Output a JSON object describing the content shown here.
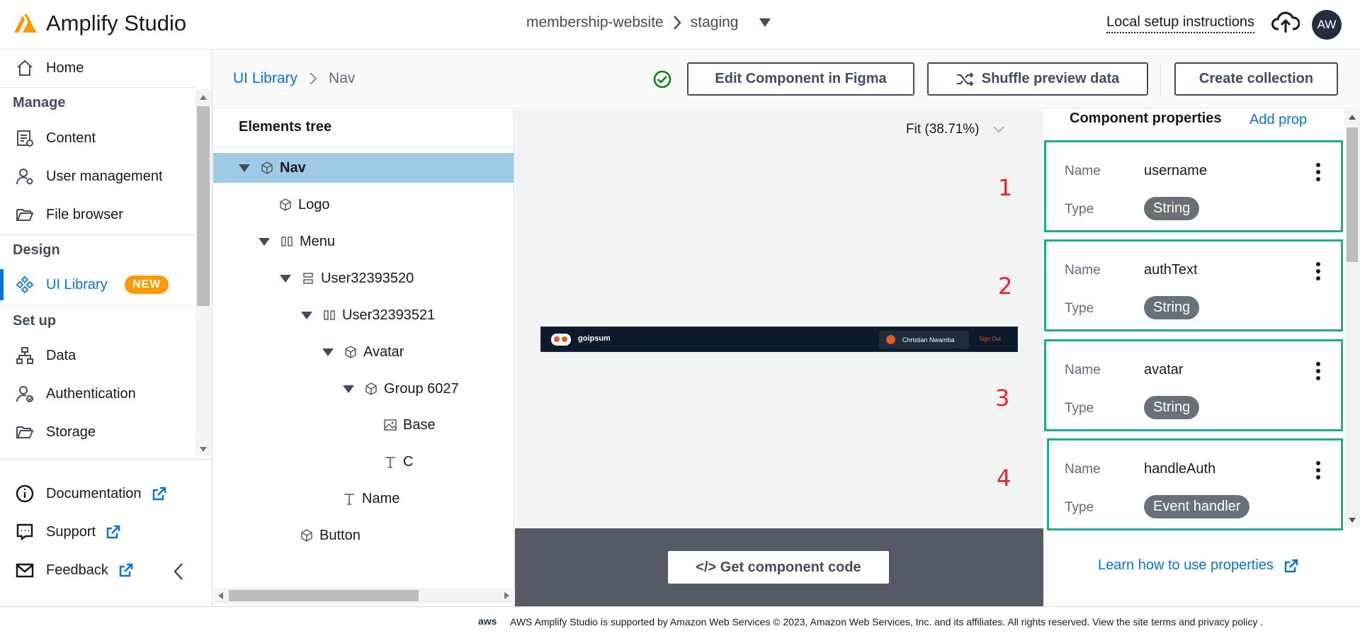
{
  "header": {
    "app_title": "Amplify Studio",
    "project": "membership-website",
    "environment": "staging",
    "setup_link": "Local setup instructions",
    "avatar_initials": "AW",
    "logo_icon": "amplify-logo",
    "accent_color": "#ff9900"
  },
  "nav": {
    "home": "Home",
    "manage_heading": "Manage",
    "content": "Content",
    "user_management": "User management",
    "file_browser": "File browser",
    "design_heading": "Design",
    "ui_library": "UI Library",
    "new_badge": "NEW",
    "setup_heading": "Set up",
    "data": "Data",
    "authentication": "Authentication",
    "storage": "Storage",
    "documentation": "Documentation",
    "support": "Support",
    "feedback": "Feedback"
  },
  "breadcrumb": {
    "root": "UI Library",
    "current": "Nav"
  },
  "toolbar": {
    "edit_figma": "Edit Component in Figma",
    "shuffle": "Shuffle preview data",
    "create_collection": "Create collection"
  },
  "tree": {
    "title": "Elements tree",
    "nodes": [
      "Nav",
      "Logo",
      "Menu",
      "User32393520",
      "User32393521",
      "Avatar",
      "Group 6027",
      "Base",
      "C",
      "Name",
      "Button"
    ]
  },
  "preview": {
    "zoom": "Fit (38.71%)",
    "component": {
      "brand": "goipsum",
      "user_name": "Christian Nwamba",
      "sign_out": "Sign Out"
    },
    "annotations": [
      "1",
      "2",
      "3",
      "4"
    ],
    "get_code": "</> Get component code"
  },
  "properties": {
    "title": "Component properties",
    "add_prop": "Add prop",
    "name_label": "Name",
    "type_label": "Type",
    "items": [
      {
        "name": "username",
        "type": "String"
      },
      {
        "name": "authText",
        "type": "String"
      },
      {
        "name": "avatar",
        "type": "String"
      },
      {
        "name": "handleAuth",
        "type": "Event handler"
      }
    ],
    "learn_link": "Learn how to use properties"
  },
  "footer": {
    "aws_logo": "aws",
    "text": "AWS Amplify Studio is supported by Amazon Web Services © 2023, Amazon Web Services, Inc. and its affiliates. All rights reserved. View the site terms and privacy policy ."
  }
}
